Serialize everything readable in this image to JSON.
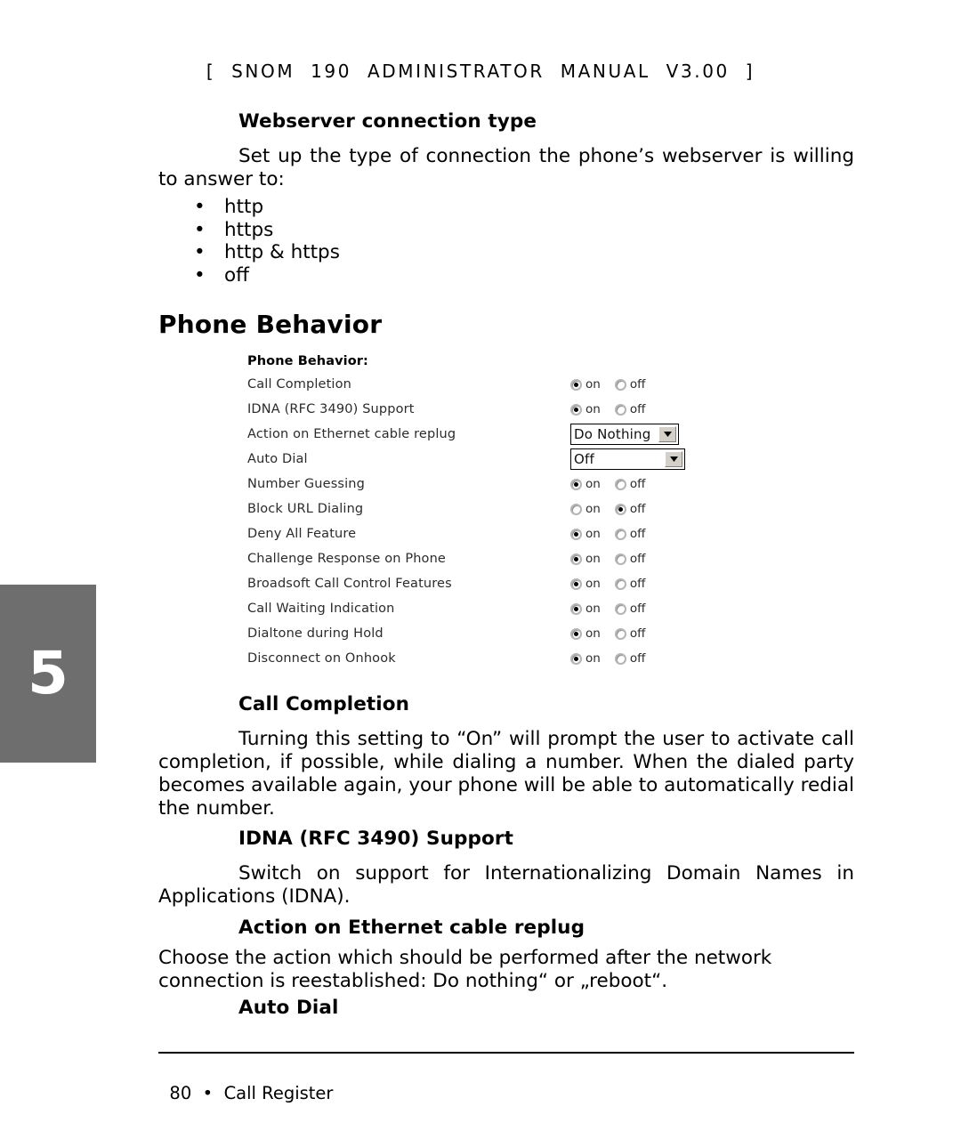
{
  "running_header": "[  SNOM  190  ADMINISTRATOR  MANUAL  V3.00  ]",
  "sections": {
    "webserver": {
      "heading": "Webserver connection type",
      "paragraph": "Set up the type of connection the phone’s webserver  is willing to answer to:",
      "bullet_glyph": "•",
      "options": [
        "http",
        "https",
        "http & https",
        "off"
      ]
    },
    "phone_behavior": {
      "heading": "Phone Behavior"
    },
    "call_completion": {
      "heading": "Call Completion",
      "paragraph": "Turning this setting to “On” will prompt the user to activate call completion, if possible, while dialing a number. When the dialed party becomes available again, your phone will be able to automatically redial the number."
    },
    "idna": {
      "heading": "IDNA (RFC 3490) Support",
      "paragraph": "Switch on support for Internationalizing Domain Names in Applications (IDNA)."
    },
    "action_replug": {
      "heading": "Action on Ethernet cable replug",
      "paragraph": "Choose the action which should be performed after the network connection is reestablished: Do nothing“ or „reboot“."
    },
    "auto_dial": {
      "heading": "Auto Dial"
    }
  },
  "chapter_tab": {
    "number": "5",
    "background": "#6e6e6e",
    "text_color": "#ffffff"
  },
  "web_ui": {
    "title": "Phone Behavior:",
    "radio_on_label": "on",
    "radio_off_label": "off",
    "rows": [
      {
        "label": "Call Completion",
        "type": "radio",
        "value": "on"
      },
      {
        "label": "IDNA (RFC 3490) Support",
        "type": "radio",
        "value": "on"
      },
      {
        "label": "Action on Ethernet cable replug",
        "type": "select",
        "value": "Do Nothing",
        "width": "narrow"
      },
      {
        "label": "Auto Dial",
        "type": "select",
        "value": "Off",
        "width": "wide"
      },
      {
        "label": "Number Guessing",
        "type": "radio",
        "value": "on"
      },
      {
        "label": "Block URL Dialing",
        "type": "radio",
        "value": "off"
      },
      {
        "label": "Deny All Feature",
        "type": "radio",
        "value": "on"
      },
      {
        "label": "Challenge Response on Phone",
        "type": "radio",
        "value": "on"
      },
      {
        "label": "Broadsoft Call Control Features",
        "type": "radio",
        "value": "on"
      },
      {
        "label": "Call Waiting Indication",
        "type": "radio",
        "value": "on"
      },
      {
        "label": "Dialtone during Hold",
        "type": "radio",
        "value": "on"
      },
      {
        "label": "Disconnect on Onhook",
        "type": "radio",
        "value": "on"
      }
    ]
  },
  "footer": {
    "page_number": "80",
    "separator": "•",
    "section_name": "Call Register"
  }
}
